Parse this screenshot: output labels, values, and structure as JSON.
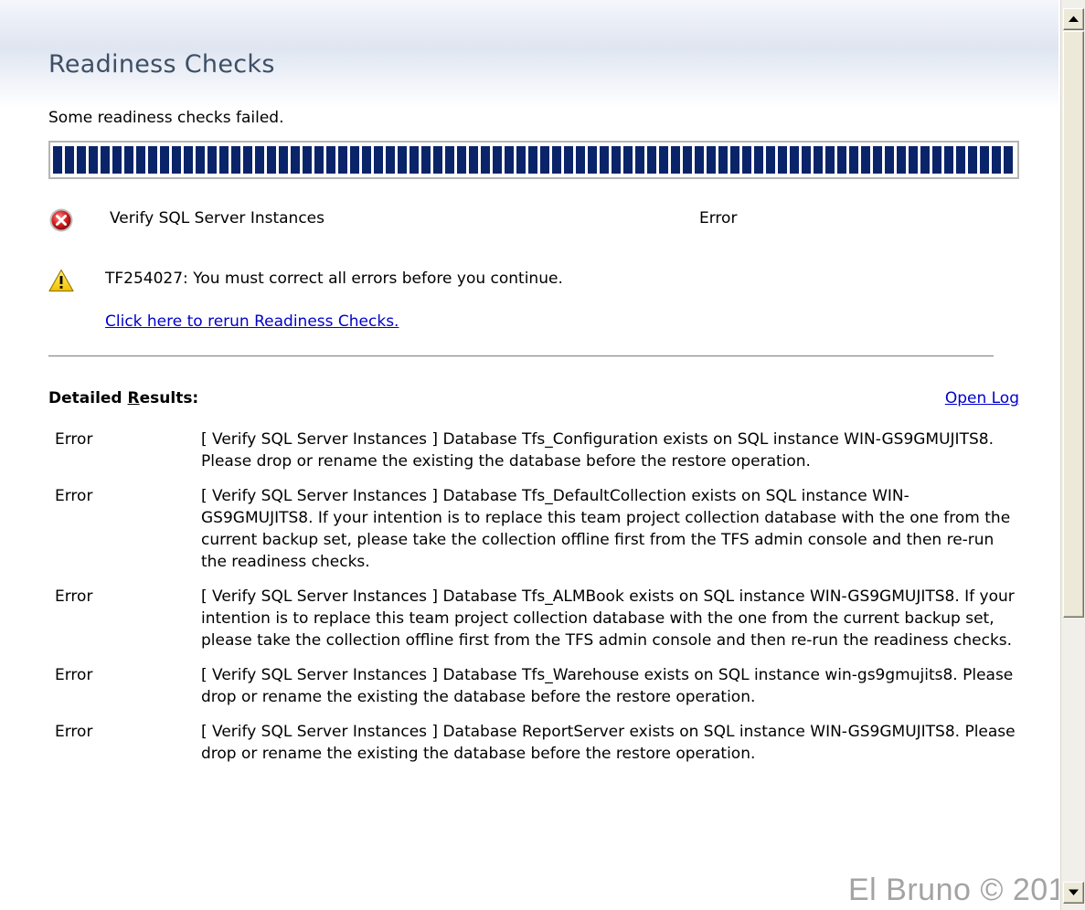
{
  "header": {
    "title": "Readiness Checks"
  },
  "status": {
    "message": "Some readiness checks failed."
  },
  "progress": {
    "value": 1.0
  },
  "checks": [
    {
      "name": "Verify SQL Server Instances",
      "status": "Error",
      "icon": "error-circle-icon"
    }
  ],
  "warning": {
    "icon": "warning-triangle-icon",
    "text": "TF254027: You must correct all errors before you continue.",
    "rerun_link": "Click here to rerun Readiness Checks."
  },
  "details": {
    "heading_before": "Detailed ",
    "heading_accel": "R",
    "heading_after": "esults:",
    "open_log": "Open Log",
    "results": [
      {
        "level": "Error",
        "message": "[ Verify SQL Server Instances ] Database Tfs_Configuration exists on SQL instance WIN-GS9GMUJITS8. Please drop or rename the existing the database before the restore operation."
      },
      {
        "level": "Error",
        "message": "[ Verify SQL Server Instances ] Database Tfs_DefaultCollection exists on SQL instance WIN-GS9GMUJITS8. If your intention is to replace this team project collection database with the one from the current backup set, please take the collection offline first from the TFS admin console and then re-run the readiness checks."
      },
      {
        "level": "Error",
        "message": "[ Verify SQL Server Instances ] Database Tfs_ALMBook exists on SQL instance WIN-GS9GMUJITS8. If your intention is to replace this team project collection database with the one from the current backup set, please take the collection offline first from the TFS admin console and then re-run the readiness checks."
      },
      {
        "level": "Error",
        "message": "[ Verify SQL Server Instances ] Database Tfs_Warehouse exists on SQL instance win-gs9gmujits8. Please drop or rename the existing the database before the restore operation."
      },
      {
        "level": "Error",
        "message": "[ Verify SQL Server Instances ] Database ReportServer exists on SQL instance WIN-GS9GMUJITS8. Please drop or rename the existing the database before the restore operation."
      }
    ]
  },
  "watermark": "El Bruno © 201"
}
